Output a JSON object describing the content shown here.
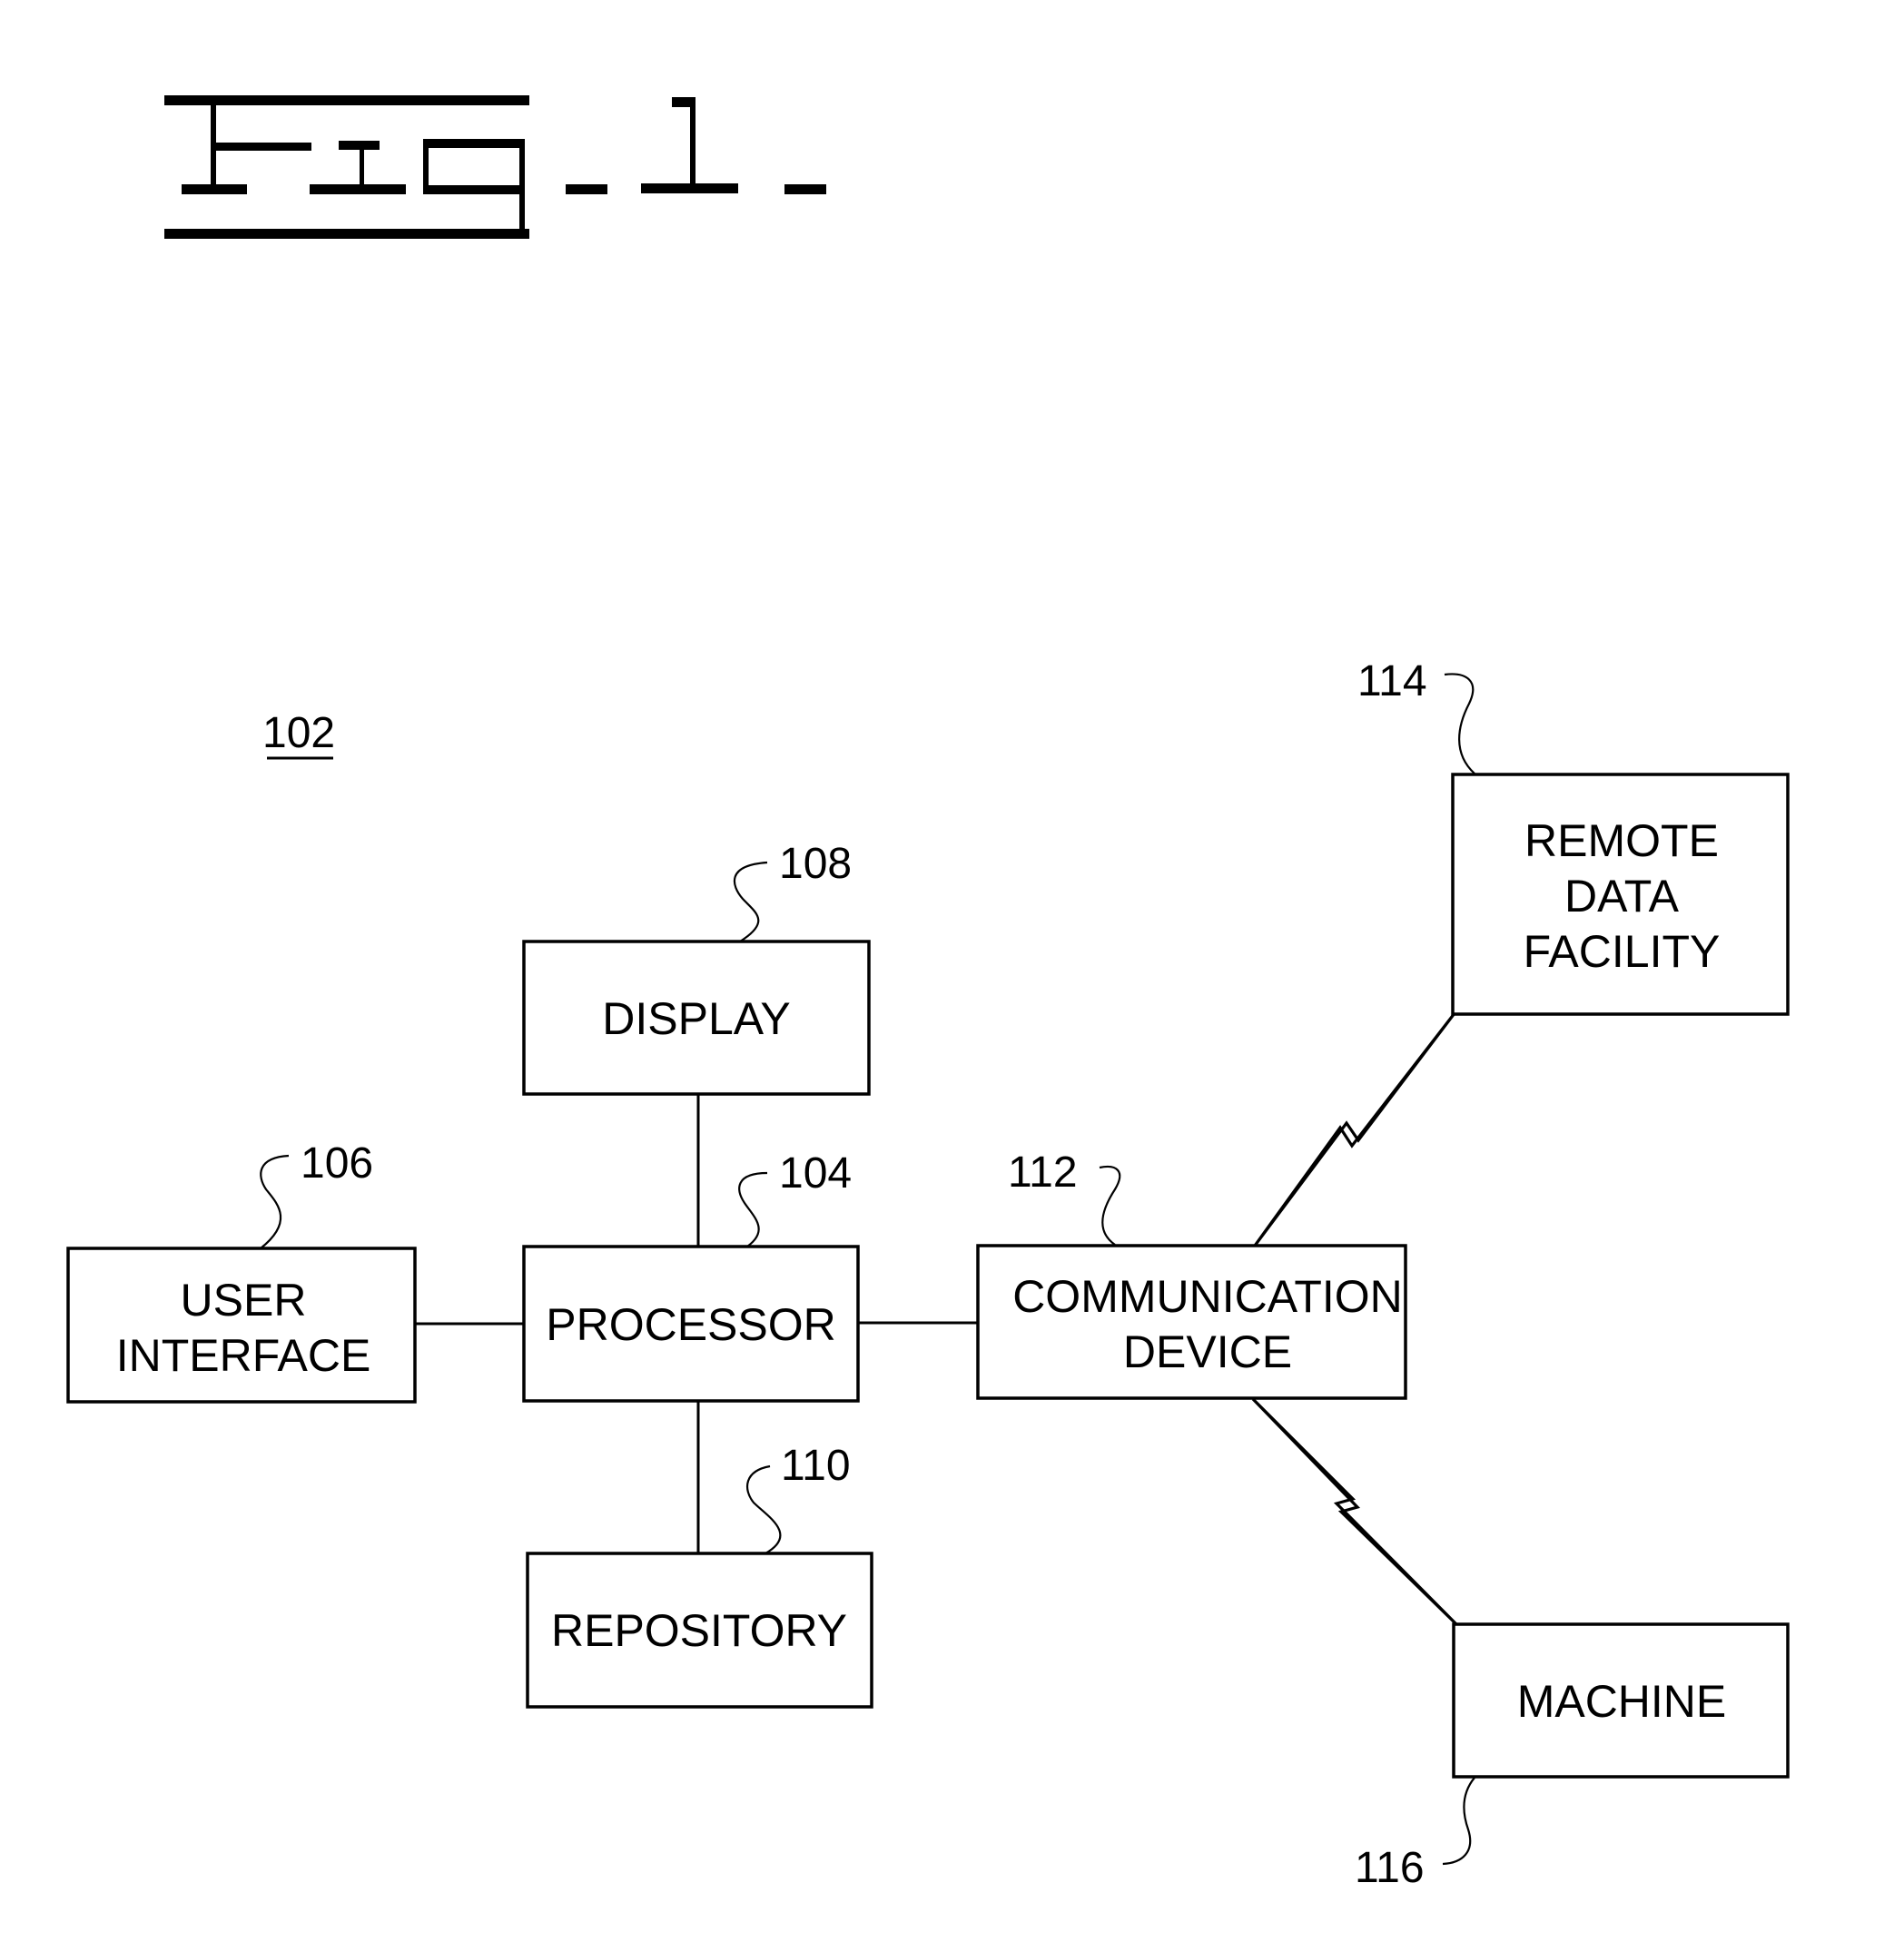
{
  "figure": {
    "title": "Fig. 1.",
    "system_ref": "102"
  },
  "nodes": {
    "display": {
      "lines": [
        "DISPLAY"
      ],
      "ref": "108"
    },
    "processor": {
      "lines": [
        "PROCESSOR"
      ],
      "ref": "104"
    },
    "user_interface": {
      "lines": [
        "USER",
        "INTERFACE"
      ],
      "ref": "106"
    },
    "repository": {
      "lines": [
        "REPOSITORY"
      ],
      "ref": "110"
    },
    "communication_device": {
      "lines": [
        "COMMUNICATION",
        "DEVICE"
      ],
      "ref": "112"
    },
    "remote_data_facility": {
      "lines": [
        "REMOTE",
        "DATA",
        "FACILITY"
      ],
      "ref": "114"
    },
    "machine": {
      "lines": [
        "MACHINE"
      ],
      "ref": "116"
    }
  },
  "connections": [
    {
      "from": "processor",
      "to": "display",
      "type": "wired"
    },
    {
      "from": "processor",
      "to": "user_interface",
      "type": "wired"
    },
    {
      "from": "processor",
      "to": "repository",
      "type": "wired"
    },
    {
      "from": "processor",
      "to": "communication_device",
      "type": "wired"
    },
    {
      "from": "communication_device",
      "to": "remote_data_facility",
      "type": "wireless"
    },
    {
      "from": "communication_device",
      "to": "machine",
      "type": "wireless"
    }
  ]
}
